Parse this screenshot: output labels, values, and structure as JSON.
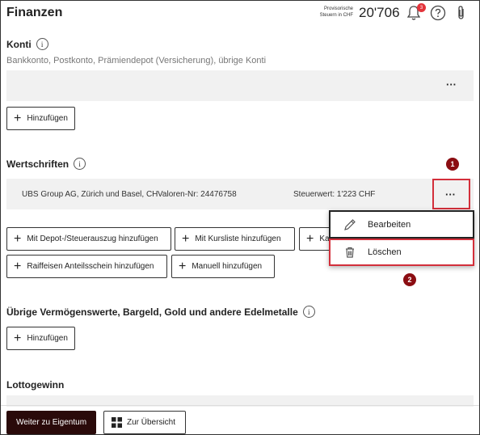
{
  "header": {
    "title": "Finanzen",
    "tax_label_line1": "Provisorische",
    "tax_label_line2": "Steuern in CHF",
    "tax_value": "20'706",
    "notification_count": "3"
  },
  "konti": {
    "title": "Konti",
    "subtitle": "Bankkonto, Postkonto, Prämiendepot (Versicherung), übrige Konti",
    "more": "···",
    "add_label": "Hinzufügen"
  },
  "wertschriften": {
    "title": "Wertschriften",
    "row": {
      "name": "UBS Group AG, Zürich und Basel, CH",
      "valor": "Valoren-Nr: 24476758",
      "tax_value": "Steuerwert: 1'223 CHF",
      "more": "···"
    },
    "buttons": {
      "depot": "Mit Depot-/Steuerauszug hinzufügen",
      "kursliste": "Mit Kursliste hinzufügen",
      "third": "Ka",
      "raiffeisen": "Raiffeisen Anteilsschein hinzufügen",
      "manuell": "Manuell hinzufügen"
    },
    "menu": {
      "edit": "Bearbeiten",
      "delete": "Löschen"
    },
    "steps": {
      "one": "1",
      "two": "2"
    }
  },
  "uebrige": {
    "title": "Übrige Vermögenswerte, Bargeld, Gold und andere Edelmetalle",
    "add_label": "Hinzufügen"
  },
  "lotto": {
    "title": "Lottogewinn"
  },
  "footer": {
    "next_label": "Weiter zu Eigentum",
    "overview_label": "Zur Übersicht"
  },
  "colors": {
    "accent_dark": "#2a0a0a",
    "highlight_red": "#d32f3b",
    "badge_red": "#8b0d12"
  }
}
